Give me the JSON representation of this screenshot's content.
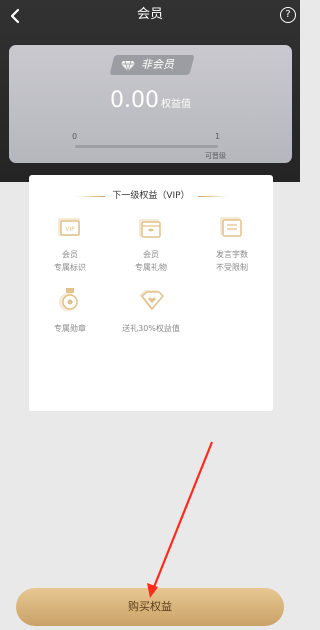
{
  "header": {
    "title": "会员",
    "back_icon": "chevron-left-icon",
    "help_label": "?"
  },
  "membership": {
    "badge": "非会员",
    "points": "0.00",
    "points_unit": "权益值",
    "progress_start": "0",
    "progress_end": "1",
    "progress_fraction": 0,
    "upgrade_label": "可晋级"
  },
  "panel": {
    "title": "下一级权益（VIP）",
    "perks": [
      {
        "icon": "vip-badge-icon",
        "line1": "会员",
        "line2": "专属标识"
      },
      {
        "icon": "gift-box-icon",
        "line1": "会员",
        "line2": "专属礼物"
      },
      {
        "icon": "message-icon",
        "line1": "发言字数",
        "line2": "不受限制"
      },
      {
        "icon": "medal-icon",
        "line1": "专属勋章",
        "line2": ""
      },
      {
        "icon": "diamond-heart-icon",
        "line1": "送礼30%权益值",
        "line2": ""
      }
    ]
  },
  "buy_button_label": "购买权益",
  "colors": {
    "gold": "#e2c28a",
    "button": "#d8b47c",
    "arrow": "#ff2a1a"
  }
}
